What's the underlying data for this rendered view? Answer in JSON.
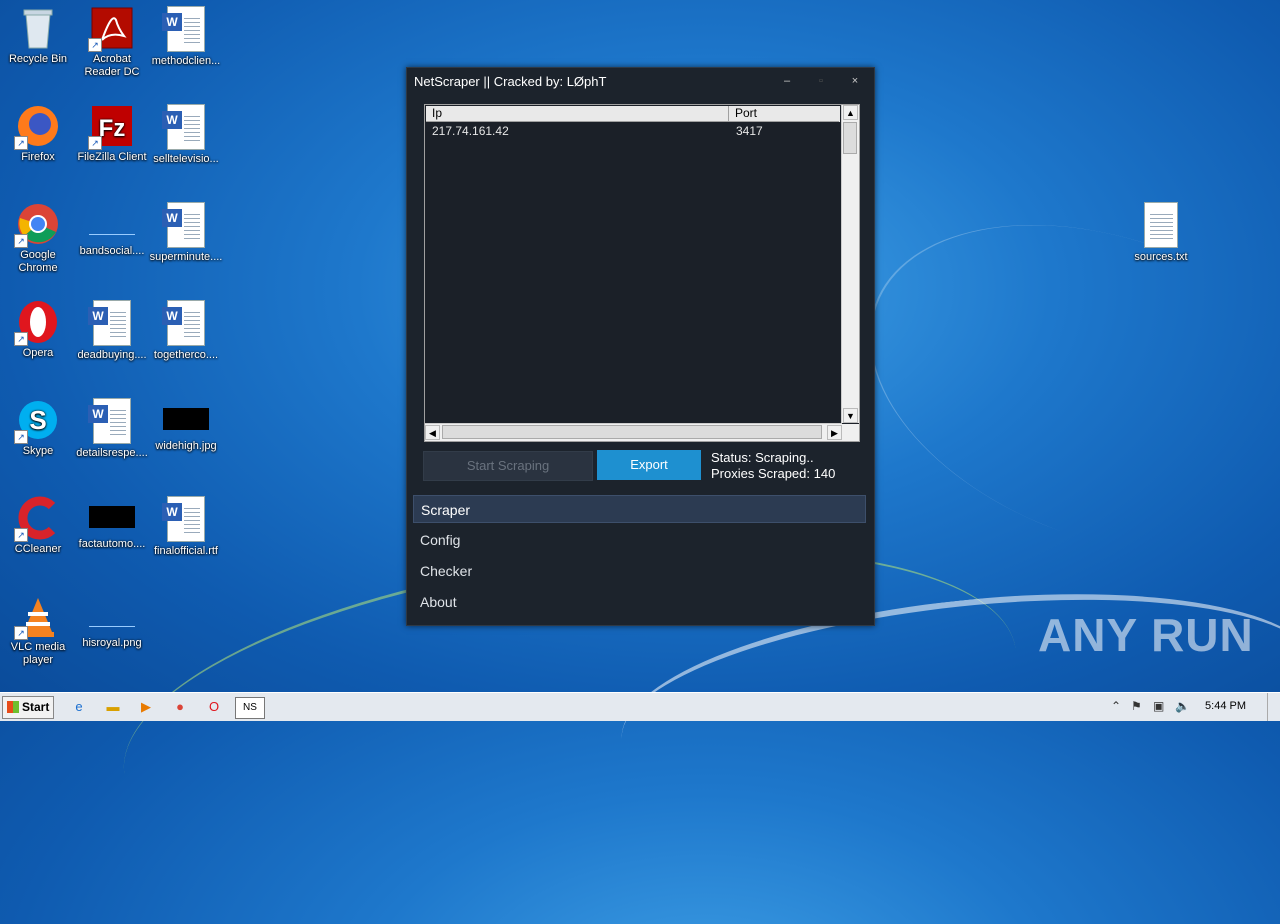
{
  "desktop_icons": [
    {
      "label": "Recycle Bin",
      "icon": "recycle-bin-icon"
    },
    {
      "label": "Acrobat Reader DC",
      "icon": "acrobat-icon"
    },
    {
      "label": "methodclien...",
      "icon": "word-doc-icon"
    },
    {
      "label": "Firefox",
      "icon": "firefox-icon"
    },
    {
      "label": "FileZilla Client",
      "icon": "filezilla-icon"
    },
    {
      "label": "selltelevisio...",
      "icon": "word-doc-icon"
    },
    {
      "label": "Google Chrome",
      "icon": "chrome-icon"
    },
    {
      "label": "bandsocial....",
      "icon": "blank-file-icon"
    },
    {
      "label": "superminute....",
      "icon": "word-doc-icon"
    },
    {
      "label": "Opera",
      "icon": "opera-icon"
    },
    {
      "label": "deadbuying....",
      "icon": "word-doc-icon"
    },
    {
      "label": "togetherco....",
      "icon": "word-doc-icon"
    },
    {
      "label": "Skype",
      "icon": "skype-icon"
    },
    {
      "label": "detailsrespe....",
      "icon": "word-doc-icon"
    },
    {
      "label": "widehigh.jpg",
      "icon": "image-file-icon"
    },
    {
      "label": "CCleaner",
      "icon": "ccleaner-icon"
    },
    {
      "label": "factautomo....",
      "icon": "image-file-icon"
    },
    {
      "label": "finalofficial.rtf",
      "icon": "word-doc-icon"
    },
    {
      "label": "VLC media player",
      "icon": "vlc-icon"
    },
    {
      "label": "hisroyal.png",
      "icon": "blank-file-icon"
    },
    {
      "label": "sources.txt",
      "icon": "text-file-icon"
    }
  ],
  "window": {
    "title": "NetScraper || Cracked by: LØphT",
    "table": {
      "columns": [
        "Ip",
        "Port"
      ],
      "rows": [
        {
          "ip": "217.74.161.42",
          "port": "3417"
        }
      ]
    },
    "start_button": "Start Scraping",
    "export_button": "Export",
    "status_text": "Status: Scraping..",
    "proxies_text": "Proxies Scraped: 140",
    "nav": [
      "Scraper",
      "Config",
      "Checker",
      "About"
    ],
    "active_nav": "Scraper"
  },
  "taskbar": {
    "start_label": "Start",
    "clock": "5:44 PM"
  },
  "watermark": "ANY RUN",
  "colors": {
    "accent": "#1e90d0",
    "window_bg": "#1c232c",
    "active_nav_bg": "#2c3b52"
  }
}
